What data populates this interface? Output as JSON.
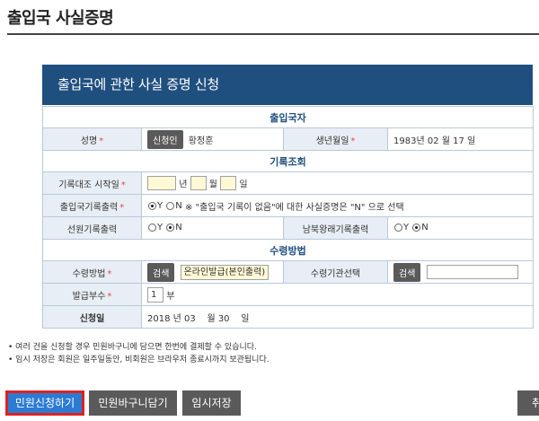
{
  "page": {
    "title": "출입국 사실증명"
  },
  "form": {
    "header": "출입국에 관한 사실 증명 신청",
    "sections": {
      "applicant": "출입국자",
      "record": "기록조회",
      "receipt": "수령방법"
    },
    "applicant": {
      "name_label": "성명",
      "applicant_button": "신청인",
      "name_value": "황정훈",
      "birth_label": "생년월일",
      "birth_value": "1983년 02 월 17 일"
    },
    "record": {
      "start_label": "기록대조 시작일",
      "year_unit": "년",
      "month_unit": "월",
      "day_unit": "일",
      "output_label": "출입국기록출력",
      "yes": "Y",
      "no": "N",
      "output_note": "※ \"출입국 기록이 없음\"에 대한 사실증명은 \"N\" 으로 선택",
      "crew_label": "선원기록출력",
      "nk_label": "남북왕래기록출력"
    },
    "receipt": {
      "method_label": "수령방법",
      "search_label": "검색",
      "method_value": "온라인발급(본인출력)",
      "agency_label": "수령기관선택",
      "copies_label": "발급부수",
      "copies_value": "1",
      "copies_unit": "부",
      "date_label": "신청일",
      "date_value": "2018 년 03    월 30    일"
    }
  },
  "required_mark": "*",
  "notes": [
    "• 여러 건을 신청할 경우 민원바구니에 담으면 한번에 결제할 수 있습니다.",
    "• 임시 저장은 회원은 일주일동안, 비회원은 브라우저 종료시까지 보관됩니다."
  ],
  "buttons": {
    "apply": "민원신청하기",
    "basket": "민원바구니담기",
    "temp_save": "임시저장",
    "right_partial": "취"
  }
}
